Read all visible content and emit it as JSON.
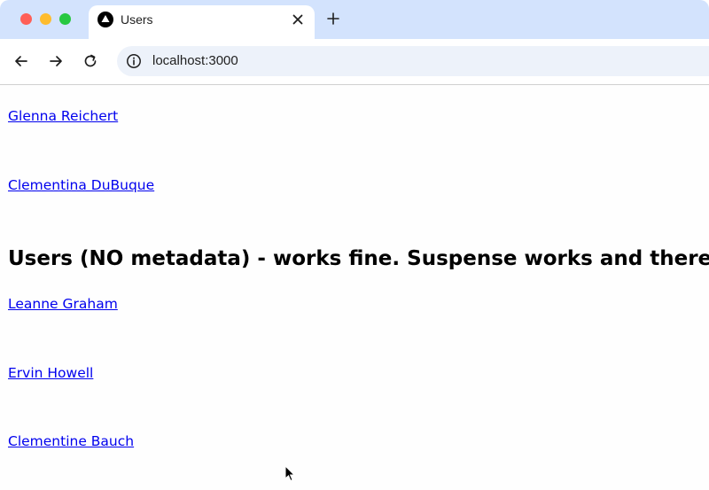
{
  "browser": {
    "tab": {
      "title": "Users",
      "favicon": "triangle-logo-icon"
    },
    "address_bar": {
      "url": "localhost:3000"
    }
  },
  "page": {
    "users_top": [
      {
        "name": "Glenna Reichert"
      },
      {
        "name": "Clementina DuBuque"
      }
    ],
    "heading": "Users (NO metadata) - works fine. Suspense works and there is load",
    "users_bottom": [
      {
        "name": "Leanne Graham"
      },
      {
        "name": "Ervin Howell"
      },
      {
        "name": "Clementine Bauch"
      }
    ]
  },
  "colors": {
    "tabstrip": "#d3e3fd",
    "omnibox": "#edf2fa",
    "link": "#0000ee"
  }
}
